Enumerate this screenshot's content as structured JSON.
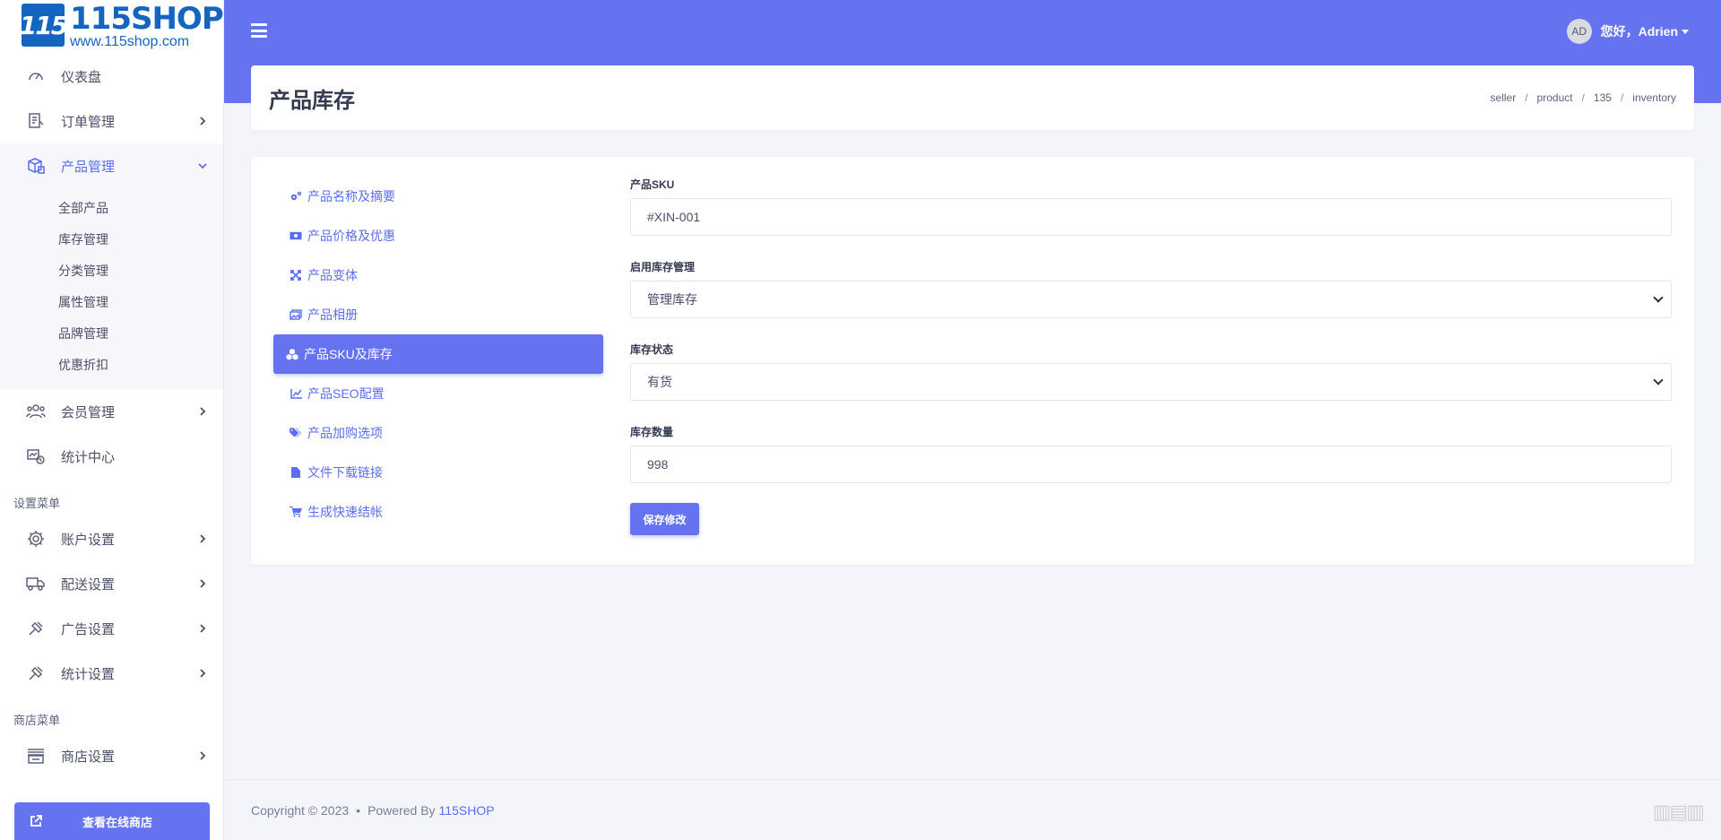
{
  "logo": {
    "mark": "115",
    "name": "115SHOP",
    "url": "www.115shop.com"
  },
  "sidebar": {
    "items": [
      {
        "label": "仪表盘",
        "icon": "speedometer-icon",
        "has_chevron": false
      },
      {
        "label": "订单管理",
        "icon": "order-list-icon",
        "has_chevron": true
      },
      {
        "label": "产品管理",
        "icon": "product-box-icon",
        "has_chevron": true,
        "active": true
      }
    ],
    "product_submenu": [
      "全部产品",
      "库存管理",
      "分类管理",
      "属性管理",
      "品牌管理",
      "优惠折扣"
    ],
    "items_after": [
      {
        "label": "会员管理",
        "icon": "users-icon",
        "has_chevron": true
      },
      {
        "label": "统计中心",
        "icon": "stats-icon",
        "has_chevron": false
      }
    ],
    "settings_title": "设置菜单",
    "settings_items": [
      {
        "label": "账户设置",
        "icon": "gear-icon"
      },
      {
        "label": "配送设置",
        "icon": "truck-icon"
      },
      {
        "label": "广告设置",
        "icon": "wrench-icon"
      },
      {
        "label": "统计设置",
        "icon": "wrench-icon"
      }
    ],
    "store_title": "商店菜单",
    "store_items": [
      {
        "label": "商店设置",
        "icon": "store-icon"
      }
    ],
    "store_button": "查看在线商店"
  },
  "header": {
    "avatar_initials": "AD",
    "greeting": "您好，",
    "username": "Adrien"
  },
  "page": {
    "title": "产品库存",
    "breadcrumb": [
      "seller",
      "product",
      "135",
      "inventory"
    ]
  },
  "tabs": [
    {
      "label": "产品名称及摘要",
      "icon": "cogs-icon"
    },
    {
      "label": "产品价格及优惠",
      "icon": "money-icon"
    },
    {
      "label": "产品变体",
      "icon": "expand-icon"
    },
    {
      "label": "产品相册",
      "icon": "images-icon"
    },
    {
      "label": "产品SKU及库存",
      "icon": "cubes-icon",
      "active": true
    },
    {
      "label": "产品SEO配置",
      "icon": "chart-line-icon"
    },
    {
      "label": "产品加购选项",
      "icon": "tags-icon"
    },
    {
      "label": "文件下载链接",
      "icon": "file-icon"
    },
    {
      "label": "生成快速结帐",
      "icon": "cart-icon"
    }
  ],
  "form": {
    "sku_label": "产品SKU",
    "sku_value": "#XIN-001",
    "manage_label": "启用库存管理",
    "manage_value": "管理库存",
    "status_label": "库存状态",
    "status_value": "有货",
    "quantity_label": "库存数量",
    "quantity_value": "998",
    "save_label": "保存修改"
  },
  "footer": {
    "copyright": "Copyright © 2023",
    "dot": "•",
    "powered": "Powered By",
    "brand": "115SHOP"
  },
  "colors": {
    "accent": "#6673f0",
    "link": "#5b6ef0"
  }
}
